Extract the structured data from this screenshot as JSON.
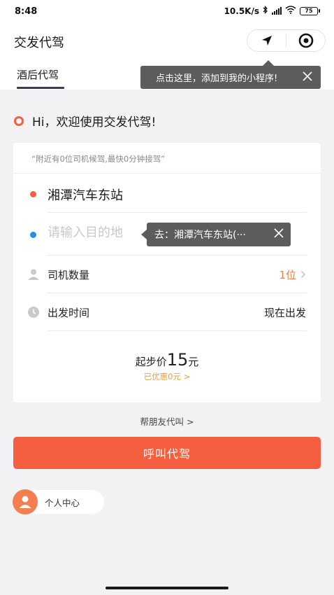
{
  "status_bar": {
    "time": "8:48",
    "network_speed": "10.5K/s",
    "battery": "75"
  },
  "app": {
    "title": "交发代驾"
  },
  "capsule": {
    "icons": [
      "navigation-arrow-icon",
      "target-circle-icon"
    ]
  },
  "add_tooltip": {
    "text": "点击这里，添加到我的小程序!"
  },
  "tabs": [
    {
      "label": "酒后代驾",
      "active": true
    }
  ],
  "greeting": {
    "text": "Hi，欢迎使用交发代驾!"
  },
  "order_card": {
    "hint": "“附近有0位司机候驾,最快0分钟接驾”",
    "origin": "湘潭汽车东站",
    "destination_placeholder": "请输入目的地",
    "destination_value": "",
    "suggestion_tooltip": "去：湘潭汽车东站(···",
    "driver_count_label": "司机数量",
    "driver_count_value": "1位",
    "depart_time_label": "出发时间",
    "depart_time_value": "现在出发",
    "price_prefix": "起步价",
    "price_amount": "15",
    "price_unit": "元",
    "discount_text": "已优惠0元 >"
  },
  "friend_link": "帮朋友代叫 >",
  "call_button": "呼叫代驾",
  "personal_center": "个人中心",
  "colors": {
    "accent": "#f4603f",
    "origin_dot": "#f2613f",
    "dest_dot": "#1f8ff2",
    "discount": "#e8a33a",
    "driver_count": "#e0844a"
  }
}
